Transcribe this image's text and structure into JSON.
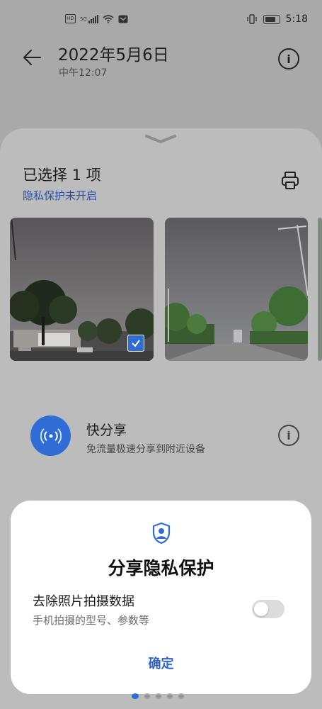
{
  "status_bar": {
    "hd_badge": "HD",
    "network": "5G",
    "time": "5:18"
  },
  "header": {
    "title": "2022年5月6日",
    "subtitle": "中午12:07"
  },
  "share_sheet": {
    "selection_title": "已选择 1 项",
    "privacy_link": "隐私保护未开启",
    "photos": [
      {
        "selected": false
      },
      {
        "selected": true
      }
    ],
    "quick_share": {
      "title": "快分享",
      "subtitle": "免流量极速分享到附近设备"
    }
  },
  "dialog": {
    "title": "分享隐私保护",
    "option_label": "去除照片拍摄数据",
    "option_desc": "手机拍摄的型号、参数等",
    "toggle_on": false,
    "confirm_label": "确定"
  },
  "colors": {
    "accent": "#2f6cd6",
    "link": "#2a4fa8"
  }
}
